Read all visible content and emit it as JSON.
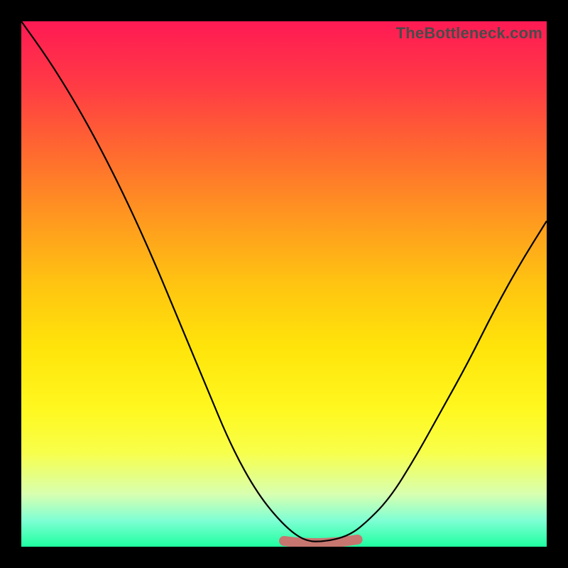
{
  "watermark": "TheBottleneck.com",
  "chart_data": {
    "type": "line",
    "title": "",
    "xlabel": "",
    "ylabel": "",
    "xlim": [
      0,
      100
    ],
    "ylim": [
      0,
      100
    ],
    "series": [
      {
        "name": "bottleneck-curve",
        "x": [
          0,
          5,
          10,
          15,
          20,
          25,
          30,
          35,
          40,
          45,
          50,
          54,
          58,
          62,
          65,
          70,
          75,
          80,
          85,
          90,
          95,
          100
        ],
        "values": [
          100,
          93,
          85,
          76,
          66,
          55,
          43,
          31,
          19,
          10,
          4,
          1,
          1,
          2,
          4,
          9,
          17,
          26,
          35,
          45,
          54,
          62
        ]
      }
    ],
    "trough": {
      "x_start": 50,
      "x_end": 64,
      "y": 1.5
    },
    "background_gradient": {
      "stops": [
        {
          "pos": 0,
          "color": "#ff1a54"
        },
        {
          "pos": 25,
          "color": "#ff6a2f"
        },
        {
          "pos": 50,
          "color": "#ffc411"
        },
        {
          "pos": 75,
          "color": "#fff820"
        },
        {
          "pos": 100,
          "color": "#1effa0"
        }
      ]
    }
  }
}
